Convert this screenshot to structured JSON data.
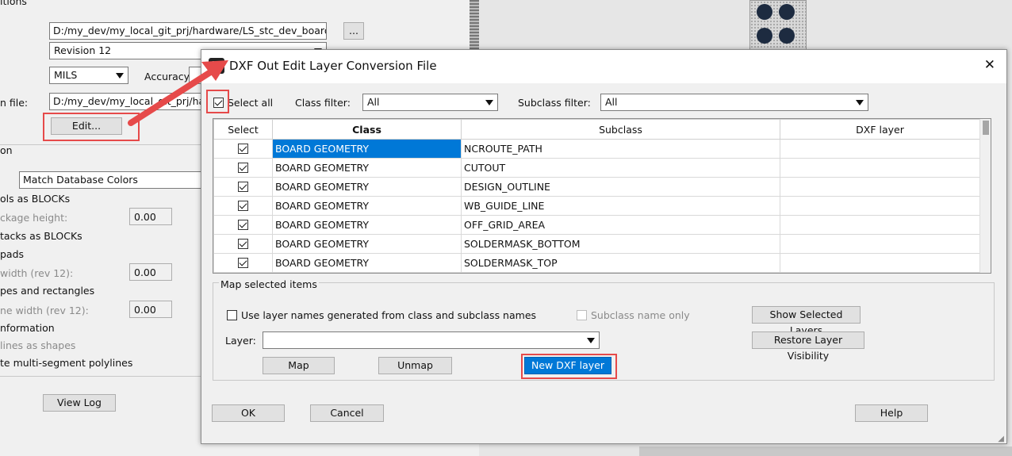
{
  "background": {
    "section_label_top": "itions",
    "source_path": "D:/my_dev/my_local_git_prj/hardware/LS_stc_dev_board/src",
    "browse_label": "...",
    "revision": "Revision 12",
    "units": "MILS",
    "accuracy_label": "Accuracy:",
    "conversion_file_label": "n file:",
    "conversion_file_path": "D:/my_dev/my_local_git_prj/hardw",
    "edit_button": "Edit...",
    "section2_label": "on",
    "color_mode": "Match Database Colors",
    "symbols_blocks": "ols as BLOCKs",
    "package_height_label": "ckage height:",
    "package_height_value": "0.00",
    "padstacks_blocks": "tacks as BLOCKs",
    "pads_label": "pads",
    "line_width_label": "width (rev 12):",
    "line_width_value": "0.00",
    "shapes_rects": "pes and rectangles",
    "outline_width_label": "ne width (rev 12):",
    "outline_width_value": "0.00",
    "information_label": "nformation",
    "lines_as_shapes": "lines as shapes",
    "multi_segment": "te multi-segment polylines",
    "view_log_button": "View Log"
  },
  "dialog": {
    "title": "DXF Out Edit Layer Conversion File",
    "close_glyph": "✕",
    "select_all_label": "Select all",
    "class_filter_label": "Class filter:",
    "class_filter_value": "All",
    "subclass_filter_label": "Subclass filter:",
    "subclass_filter_value": "All",
    "columns": [
      "Select",
      "Class",
      "Subclass",
      "DXF layer"
    ],
    "rows": [
      {
        "checked": true,
        "class": "BOARD GEOMETRY",
        "subclass": "NCROUTE_PATH",
        "layer": ""
      },
      {
        "checked": true,
        "class": "BOARD GEOMETRY",
        "subclass": "CUTOUT",
        "layer": ""
      },
      {
        "checked": true,
        "class": "BOARD GEOMETRY",
        "subclass": "DESIGN_OUTLINE",
        "layer": ""
      },
      {
        "checked": true,
        "class": "BOARD GEOMETRY",
        "subclass": "WB_GUIDE_LINE",
        "layer": ""
      },
      {
        "checked": true,
        "class": "BOARD GEOMETRY",
        "subclass": "OFF_GRID_AREA",
        "layer": ""
      },
      {
        "checked": true,
        "class": "BOARD GEOMETRY",
        "subclass": "SOLDERMASK_BOTTOM",
        "layer": ""
      },
      {
        "checked": true,
        "class": "BOARD GEOMETRY",
        "subclass": "SOLDERMASK_TOP",
        "layer": ""
      }
    ],
    "map_group_label": "Map selected items",
    "use_layer_names_label": "Use layer names generated from class and subclass names",
    "subclass_only_label": "Subclass name only",
    "show_selected_button": "Show Selected Layers",
    "restore_visibility_button": "Restore Layer Visibility",
    "layer_label": "Layer:",
    "layer_value": "",
    "map_button": "Map",
    "unmap_button": "Unmap",
    "new_dxf_layer_button": "New DXF layer",
    "ok_button": "OK",
    "cancel_button": "Cancel",
    "help_button": "Help"
  },
  "colors": {
    "highlight": "#e64a4a",
    "selection": "#0078d7"
  }
}
